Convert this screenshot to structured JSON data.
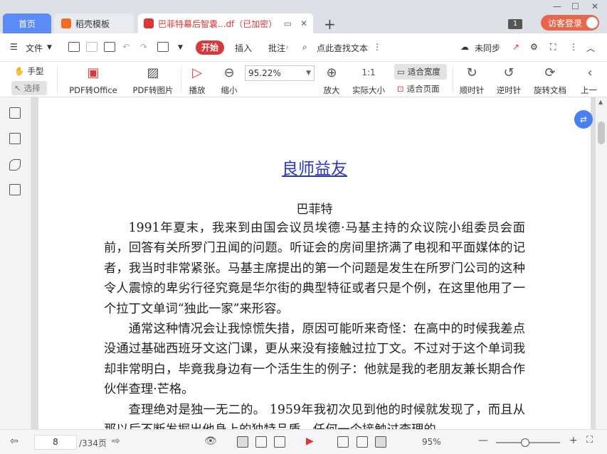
{
  "tabs": {
    "home": "首页",
    "template": "稻壳模板",
    "doc": "巴菲特幕后智囊...df（已加密）",
    "add": "+"
  },
  "window": {
    "page_badge": "1",
    "login": "访客登录"
  },
  "menubar": {
    "file": "文件",
    "start": "开始",
    "insert": "插入",
    "annotate": "批注",
    "search_placeholder": "点此查找文本",
    "sync": "未同步"
  },
  "ribbon": {
    "hand": "手型",
    "select": "选择",
    "pdf_to_office": "PDF转Office",
    "pdf_to_image": "PDF转图片",
    "play": "播放",
    "zoom_out": "缩小",
    "zoom_value": "95.22%",
    "zoom_in": "放大",
    "actual_size": "实际大小",
    "fit_width": "适合宽度",
    "fit_page": "适合页面",
    "rotate_cw": "顺时针",
    "rotate_ccw": "逆时针",
    "rotate_doc": "旋转文档",
    "prev": "上一"
  },
  "document": {
    "title": "良师益友",
    "author": "巴菲特",
    "paragraphs": [
      "1991年夏末，我来到由国会议员埃德·马基主持的众议院小组委员会面前，回答有关所罗门丑闻的问题。听证会的房间里挤满了电视和平面媒体的记者，我当时非常紧张。马基主席提出的第一个问题是发生在所罗门公司的这种令人震惊的卑劣行径究竟是华尔街的典型特征或者只是个例，在这里他用了一个拉丁文单词“独此一家”来形容。",
      "通常这种情况会让我惊慌失措，原因可能听来奇怪：在高中的时候我差点没通过基础西班牙文这门课，更从来没有接触过拉丁文。不过对于这个单词我却非常明白，毕竟我身边有一个活生生的例子：他就是我的老朋友兼长期合作伙伴查理·芒格。",
      "查理绝对是独一无二的。 1959年我初次见到他的时候就发现了，而且从那以后不断发掘出他身上的独特品质。任何一个接触过查理的"
    ]
  },
  "statusbar": {
    "current_page": "8",
    "total_pages": "/334页",
    "zoom": "95%",
    "zoom_fraction": 0.45
  }
}
